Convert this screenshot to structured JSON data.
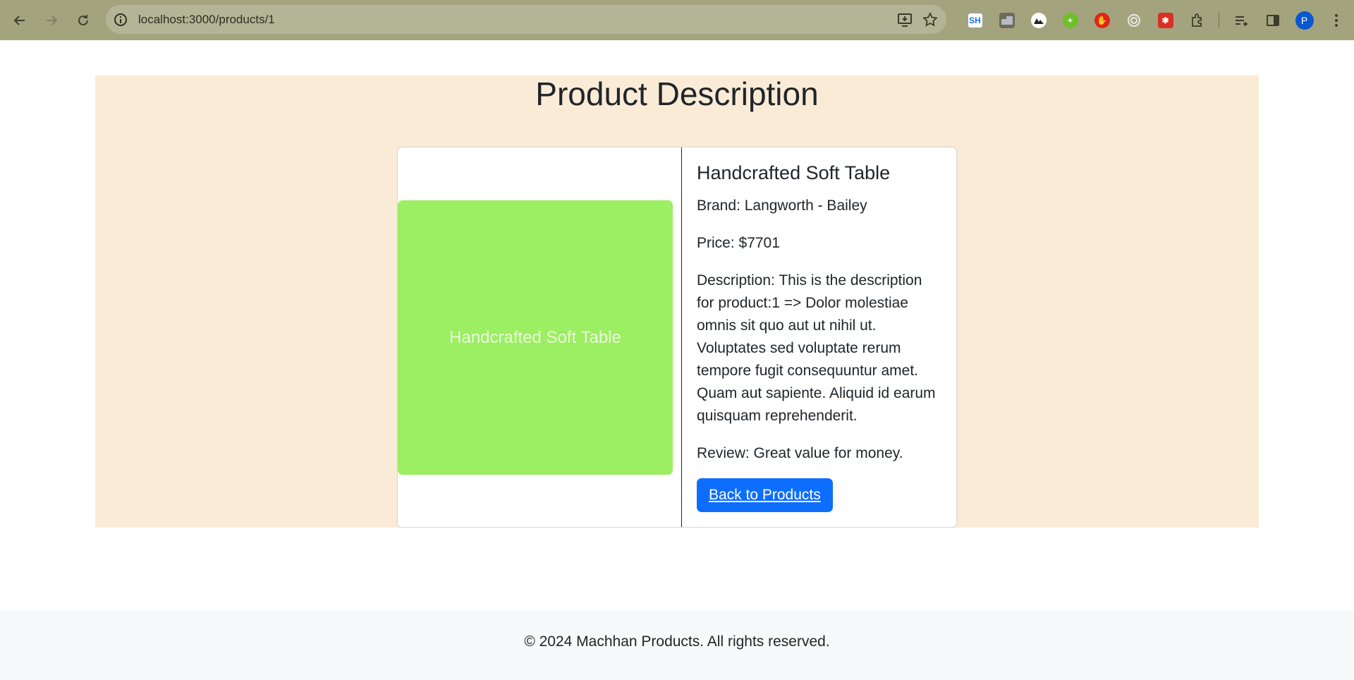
{
  "browser": {
    "url": "localhost:3000/products/1",
    "extensions": [
      {
        "name": "sh-extension",
        "label": "SH",
        "bg": "#ffffff",
        "fg": "#1a73e8"
      },
      {
        "name": "tab-manager-extension",
        "label": "",
        "bg": "#6b6d55",
        "fg": "#ffffff"
      },
      {
        "name": "mountain-extension",
        "label": "",
        "bg": "#ffffff",
        "fg": "#222222"
      },
      {
        "name": "green-plus-extension",
        "label": "",
        "bg": "#6fbf2a",
        "fg": "#ffffff"
      },
      {
        "name": "adblock-extension",
        "label": "",
        "bg": "#e2231a",
        "fg": "#ffffff"
      },
      {
        "name": "target-extension",
        "label": "",
        "bg": "#d6d6c8",
        "fg": "#555555"
      },
      {
        "name": "puzzle-red-extension",
        "label": "",
        "bg": "#d93025",
        "fg": "#ffffff"
      }
    ],
    "profile_initial": "P"
  },
  "page": {
    "title": "Product Description",
    "product": {
      "image_text": "Handcrafted Soft Table",
      "name": "Handcrafted Soft Table",
      "brand": "Brand: Langworth - Bailey",
      "price": "Price: $7701",
      "description": "Description: This is the description for product:1 => Dolor molestiae omnis sit quo aut ut nihil ut. Voluptates sed voluptate rerum tempore fugit consequuntur amet. Quam aut sapiente. Aliquid id earum quisquam reprehenderit.",
      "review": "Review: Great value for money."
    },
    "back_button": "Back to Products",
    "footer": "© 2024 Machhan Products. All rights reserved."
  },
  "colors": {
    "banner": "#faebd7",
    "image_bg": "#9cee62",
    "button": "#0d6efd",
    "footer_bg": "#f8f9fa",
    "toolbar": "#a3a47e"
  }
}
